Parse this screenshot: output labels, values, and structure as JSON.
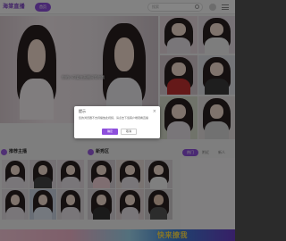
{
  "header": {
    "logo": "海棠直播",
    "nav_active": "首页",
    "search_placeholder": "搜索"
  },
  "banner": {
    "caption": "你的小可爱在直播间等你哦"
  },
  "sections": {
    "left_title": "推荐主播",
    "mid_title": "新秀区",
    "tabs": [
      "热门",
      "附近",
      "新人"
    ]
  },
  "ad": {
    "text": "快来撩我"
  },
  "dialog": {
    "title": "提示",
    "close": "×",
    "message": "您的浏览器不支持播放此视频，请点击下载客户端观看直播",
    "ok": "确定",
    "cancel": "取消"
  },
  "colors": {
    "accent": "#8e4fdc",
    "overlay": "rgba(0,0,0,0.48)"
  }
}
